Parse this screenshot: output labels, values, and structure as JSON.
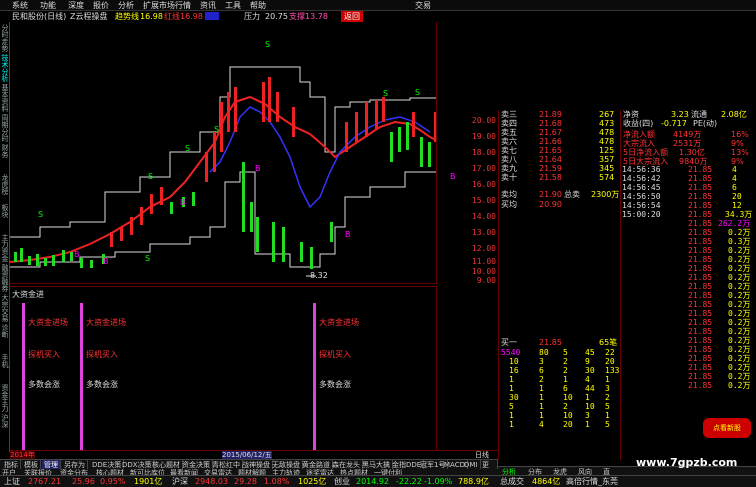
{
  "menu": [
    "系统",
    "功能",
    "深度",
    "报价",
    "分析",
    "扩展市场行情",
    "资讯",
    "工具",
    "帮助",
    "交易"
  ],
  "title": {
    "name": "民和股份(日线)",
    "template": "Z云程操盘",
    "ind_label": "趋势线",
    "ind_value": "16.98",
    "red_label": "红线",
    "red_value": "16.98",
    "press_label": "压力",
    "press_value": "20.75",
    "support_label": "支撑",
    "support_value": "13.78",
    "back_label": "返回"
  },
  "left_tabs": [
    "分时走势",
    "技术分析",
    "基本资料",
    "周期分时",
    "财务",
    "龙虎榜",
    "板块",
    "主力资金",
    "融资融券",
    "大宗交易",
    "诊断",
    "手机",
    "资金主力",
    "沪深"
  ],
  "price_axis": [
    "20.00",
    "19.00",
    "18.00",
    "17.00",
    "16.00",
    "15.00",
    "14.00",
    "13.00",
    "12.00",
    "11.00",
    "10.00",
    "9.00"
  ],
  "low_marker": "8.32",
  "chart_signals": [
    "S",
    "S",
    "S",
    "B",
    "B",
    "S",
    "S",
    "B",
    "S",
    "S",
    "B",
    "B",
    "S",
    "B"
  ],
  "ind_panel": {
    "title": "大资金进",
    "labels": [
      "大资金进场",
      "探机买入",
      "多数会涨"
    ]
  },
  "date_bar": {
    "year": "2014年",
    "date": "2015/06/12/五",
    "unit": "日线"
  },
  "bottom_tabs": [
    "指标",
    "模板",
    "管理",
    "另存为",
    "DDE决策",
    "DDX决策",
    "核心题材",
    "资金决策",
    "青松红中",
    "战神操盘",
    "无敌操盘",
    "黄金路道",
    "森在龙头",
    "黑马大擒",
    "金指DDE",
    "冠军1号",
    "MACD",
    "DMI",
    "更多"
  ],
  "sell_orders": [
    [
      "卖三",
      "21.89",
      "267"
    ],
    [
      "卖四",
      "21.68",
      "473"
    ],
    [
      "卖五",
      "21.67",
      "478"
    ],
    [
      "卖六",
      "21.66",
      "478"
    ],
    [
      "卖七",
      "21.65",
      "125"
    ],
    [
      "卖八",
      "21.64",
      "357"
    ],
    [
      "卖九",
      "21.59",
      "345"
    ],
    [
      "卖十",
      "21.58",
      "574"
    ]
  ],
  "sell_extra": [
    [
      "卖均",
      "21.90",
      "总卖",
      "2300万"
    ],
    [
      "买均",
      "20.90",
      "",
      ""
    ]
  ],
  "buy_line": {
    "label": "买一",
    "price": "21.85",
    "vol": "65笔"
  },
  "ticks": [
    [
      "5540",
      "80",
      "5",
      "45",
      "22"
    ],
    [
      "10",
      "3",
      "2",
      "9",
      "20"
    ],
    [
      "16",
      "6",
      "2",
      "30",
      "133"
    ],
    [
      "1",
      "2",
      "1",
      "4",
      "1"
    ],
    [
      "1",
      "1",
      "6",
      "44",
      "3"
    ],
    [
      "30",
      "1",
      "10",
      "1",
      "2"
    ],
    [
      "5",
      "1",
      "2",
      "10",
      "5"
    ],
    [
      "1",
      "1",
      "10",
      "3",
      "1"
    ],
    [
      "1",
      "4",
      "20",
      "1",
      "5"
    ]
  ],
  "summary": {
    "net_label": "净资",
    "net_value": "3.23",
    "circ_label": "流通",
    "circ_value": "2.08亿",
    "ret_label": "收益(四)",
    "ret_value": "-0.717",
    "pe_label": "PE(动)",
    "net_in": "净流入额",
    "net_in_value": "4149万",
    "net_in_pct": "16%",
    "big_in": "大宗流入",
    "big_in_value": "2531万",
    "big_in_pct": "9%",
    "d5_net": "5日净流入额",
    "d5_net_value": "1.30亿",
    "d5_net_pct": "13%",
    "d5_big": "5日大宗流入",
    "d5_big_value": "9840万",
    "d5_big_pct": "9%"
  },
  "trades": [
    [
      "14:56:36",
      "21.85",
      "4"
    ],
    [
      "14:56:42",
      "21.85",
      "4"
    ],
    [
      "14:56:45",
      "21.85",
      "6"
    ],
    [
      "14:56:50",
      "21.85",
      "20"
    ],
    [
      "14:56:54",
      "21.85",
      "12"
    ],
    [
      "15:00:20",
      "21.85",
      "34.3万"
    ],
    [
      "",
      "21.85",
      "262.2万"
    ],
    [
      "",
      "21.85",
      "0.2万"
    ],
    [
      "",
      "21.85",
      "0.3万"
    ],
    [
      "",
      "21.85",
      "0.2万"
    ],
    [
      "",
      "21.85",
      "0.2万"
    ],
    [
      "",
      "21.85",
      "0.2万"
    ],
    [
      "",
      "21.85",
      "0.2万"
    ],
    [
      "",
      "21.85",
      "0.2万"
    ],
    [
      "",
      "21.85",
      "0.2万"
    ],
    [
      "",
      "21.85",
      "0.2万"
    ],
    [
      "",
      "21.85",
      "0.2万"
    ],
    [
      "",
      "21.85",
      "0.2万"
    ],
    [
      "",
      "21.85",
      "0.2万"
    ],
    [
      "",
      "21.85",
      "0.2万"
    ],
    [
      "",
      "21.85",
      "0.2万"
    ],
    [
      "",
      "21.85",
      "0.2万"
    ],
    [
      "",
      "21.85",
      "0.2万"
    ],
    [
      "",
      "21.85",
      "0.2万"
    ],
    [
      "",
      "21.85",
      "0.2万"
    ]
  ],
  "right_tabs": [
    "分析",
    "分布",
    "龙虎",
    "风向",
    "直"
  ],
  "status": {
    "sh": "上证",
    "sh_val": "2767.21",
    "sh_chg": "25.96",
    "sh_pct": "0.95%",
    "sh_amt": "1901亿",
    "sz": "沪深",
    "sz_val": "2948.03",
    "sz_chg": "29.28",
    "sz_pct": "1.08%",
    "sz_amt": "1025亿",
    "cy": "创业",
    "cy_val": "2014.92",
    "cy_chg": "-22.22",
    "cy_pct": "-1.09%",
    "cy_amt": "788.9亿",
    "total": "总成交",
    "total_val": "4864亿",
    "hint": "高倍行情_东莞"
  },
  "bottom2": [
    "开户",
    "关联报价",
    "资金分布",
    "核心题材",
    "新可比库位",
    "最看新闻",
    "交易雷达",
    "题材解题",
    "主力轨迹",
    "途奖雷达",
    "热点题材",
    "一键付利"
  ],
  "watermark": "www.7gpzb.com",
  "promo": "点看新股"
}
